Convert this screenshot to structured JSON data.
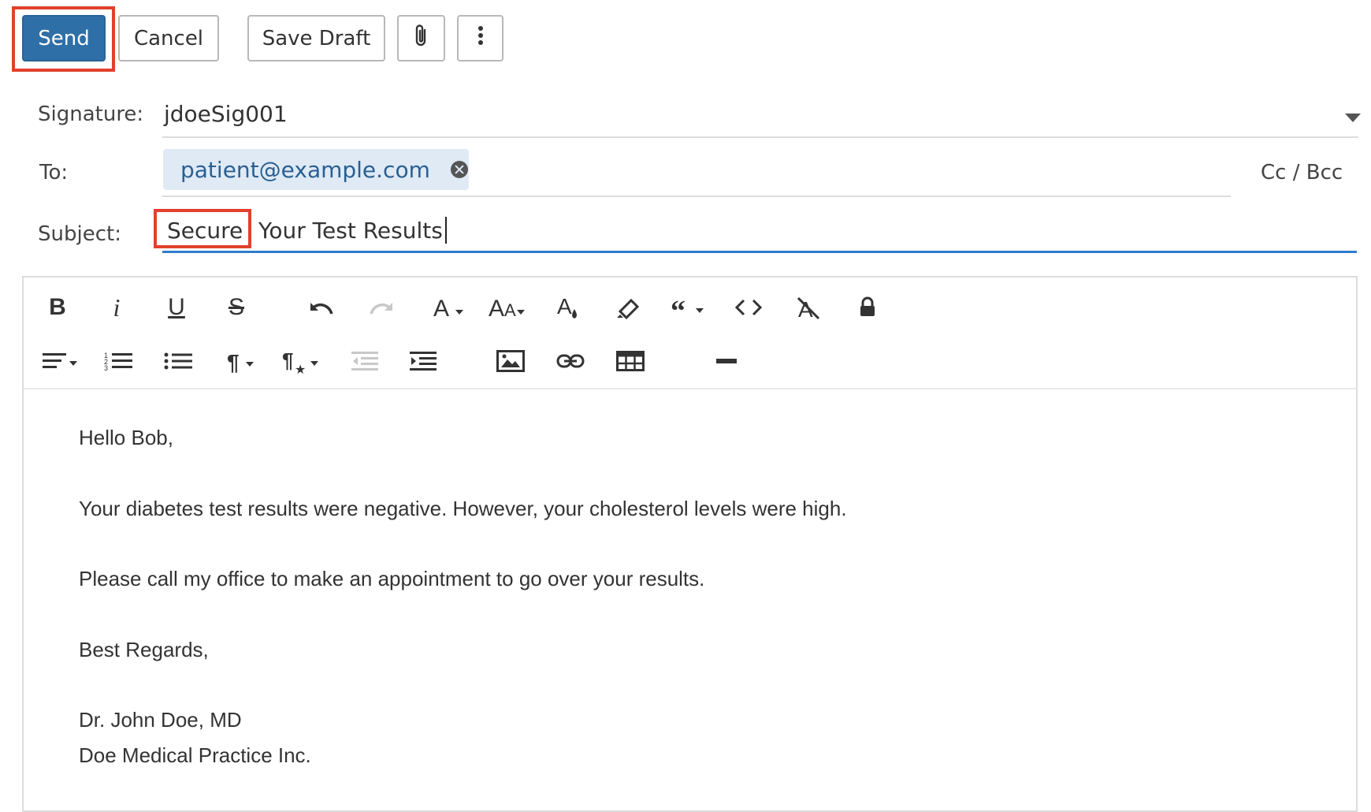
{
  "actions": {
    "send_label": "Send",
    "cancel_label": "Cancel",
    "save_draft_label": "Save Draft",
    "attach_icon": "paperclip-icon",
    "more_icon": "more-vertical-icon"
  },
  "form": {
    "signature_label": "Signature:",
    "signature_value": "jdoeSig001",
    "to_label": "To:",
    "to_recipients": [
      "patient@example.com"
    ],
    "cc_bcc_label": "Cc / Bcc",
    "subject_label": "Subject:",
    "subject_tag": "Secure",
    "subject_value": "Your Test Results"
  },
  "toolbar": {
    "row1": [
      "bold-icon",
      "italic-icon",
      "underline-icon",
      "strikethrough-icon",
      "undo-icon",
      "redo-icon",
      "font-family-icon",
      "font-size-icon",
      "text-color-icon",
      "highlight-icon",
      "quote-icon",
      "code-view-icon",
      "clear-formatting-icon",
      "lock-icon"
    ],
    "row2": [
      "align-icon",
      "ordered-list-icon",
      "unordered-list-icon",
      "paragraph-format-icon",
      "paragraph-style-icon",
      "outdent-icon",
      "indent-icon",
      "insert-image-icon",
      "insert-link-icon",
      "insert-table-icon",
      "horizontal-line-icon"
    ],
    "bold_label": "B",
    "italic_label": "i",
    "underline_label": "U",
    "strike_label": "S"
  },
  "message": {
    "greeting": "Hello Bob,",
    "line1": "Your diabetes test results were negative. However, your cholesterol levels were high.",
    "line2": "Please call my office to make an appointment to go over your results.",
    "closing": "Best Regards,",
    "sig_name": "Dr. John Doe, MD",
    "sig_org": "Doe Medical Practice Inc."
  },
  "colors": {
    "primary": "#2f6fa7",
    "highlight_box": "#e1412b",
    "chip_bg": "#dfeaf5",
    "chip_text": "#2a5f92",
    "active_underline": "#2f7dcc"
  }
}
